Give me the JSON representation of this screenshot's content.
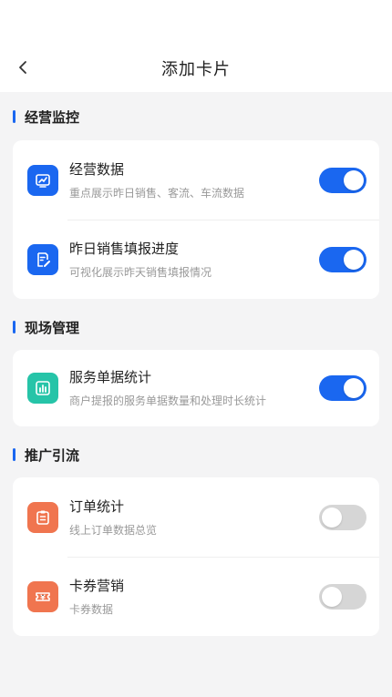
{
  "header": {
    "title": "添加卡片"
  },
  "colors": {
    "accent": "#1a67f0",
    "monitor_icon": "#1a67f0",
    "site_icon": "#26c4a8",
    "promo_icon": "#f0754f"
  },
  "sections": [
    {
      "title": "经营监控",
      "items": [
        {
          "title": "经营数据",
          "subtitle": "重点展示昨日销售、客流、车流数据",
          "icon": "trend-chart-icon",
          "enabled": true
        },
        {
          "title": "昨日销售填报进度",
          "subtitle": "可视化展示昨天销售填报情况",
          "icon": "edit-report-icon",
          "enabled": true
        }
      ]
    },
    {
      "title": "现场管理",
      "items": [
        {
          "title": "服务单据统计",
          "subtitle": "商户提报的服务单据数量和处理时长统计",
          "icon": "bar-chart-icon",
          "enabled": true
        }
      ]
    },
    {
      "title": "推广引流",
      "items": [
        {
          "title": "订单统计",
          "subtitle": "线上订单数据总览",
          "icon": "clipboard-icon",
          "enabled": false
        },
        {
          "title": "卡券营销",
          "subtitle": "卡券数据",
          "icon": "coupon-icon",
          "enabled": false
        }
      ]
    }
  ]
}
